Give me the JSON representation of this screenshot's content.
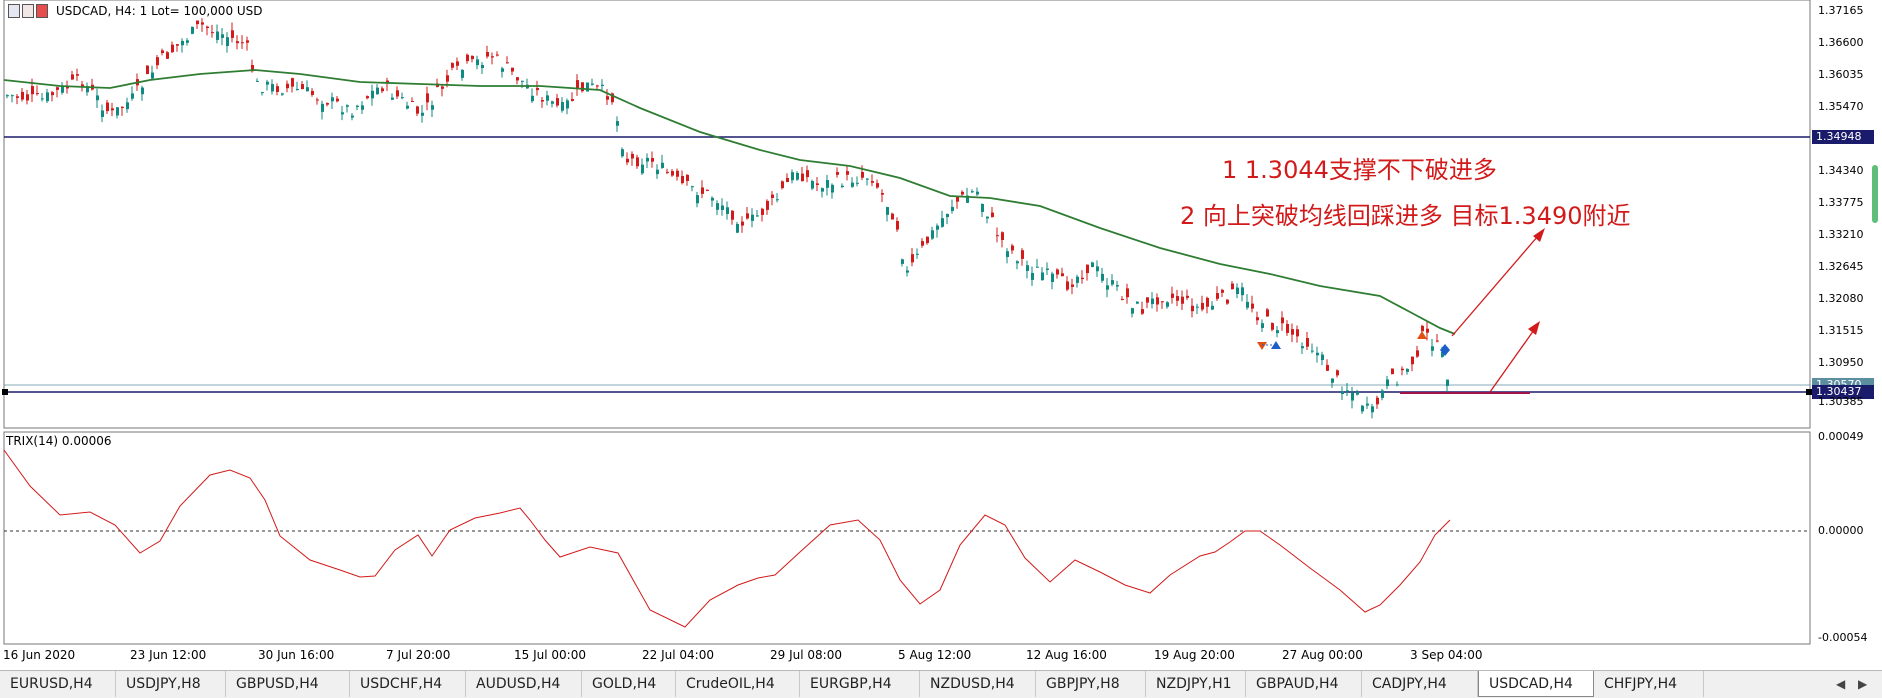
{
  "window": {
    "symbol_title": "USDCAD, H4:  1 Lot= 100,000 USD"
  },
  "annotations": {
    "line1": "1   1.3044支撑不下破进多",
    "line2": "2 向上突破均线回踩进多 目标1.3490附近"
  },
  "price_axis": {
    "labels": [
      "1.37165",
      "1.36600",
      "1.36035",
      "1.35470",
      "1.34340",
      "1.33775",
      "1.33210",
      "1.32645",
      "1.32080",
      "1.31515",
      "1.30950",
      "1.30385"
    ],
    "tag_upper": "1.34948",
    "tag_current": "1.30570",
    "tag_lower": "1.30437"
  },
  "indicator": {
    "title": "TRIX(14) 0.00006",
    "labels": [
      "0.00049",
      "0.00000",
      "-0.00054"
    ]
  },
  "time_axis": {
    "labels": [
      "16 Jun 2020",
      "23 Jun 12:00",
      "30 Jun 16:00",
      "7 Jul 20:00",
      "15 Jul 00:00",
      "22 Jul 04:00",
      "29 Jul 08:00",
      "5 Aug 12:00",
      "12 Aug 16:00",
      "19 Aug 20:00",
      "27 Aug 00:00",
      "3 Sep 04:00"
    ]
  },
  "tabs": [
    {
      "label": "EURUSD,H4",
      "active": false
    },
    {
      "label": "USDJPY,H8",
      "active": false
    },
    {
      "label": "GBPUSD,H4",
      "active": false
    },
    {
      "label": "USDCHF,H4",
      "active": false
    },
    {
      "label": "AUDUSD,H4",
      "active": false
    },
    {
      "label": "GOLD,H4",
      "active": false
    },
    {
      "label": "CrudeOIL,H4",
      "active": false
    },
    {
      "label": "EURGBP,H4",
      "active": false
    },
    {
      "label": "NZDUSD,H4",
      "active": false
    },
    {
      "label": "GBPJPY,H8",
      "active": false
    },
    {
      "label": "NZDJPY,H1",
      "active": false
    },
    {
      "label": "GBPAUD,H4",
      "active": false
    },
    {
      "label": "CADJPY,H4",
      "active": false
    },
    {
      "label": "USDCAD,H4",
      "active": true
    },
    {
      "label": "CHFJPY,H4",
      "active": false
    }
  ],
  "colors": {
    "bull": "#0f8a80",
    "bear": "#d21a1a",
    "ma": "#2e7d32",
    "hline": "#1b1b6b",
    "tag_bg": "#1b1b6b",
    "trix": "#d21a1a",
    "annotation": "#d21a1a"
  }
}
